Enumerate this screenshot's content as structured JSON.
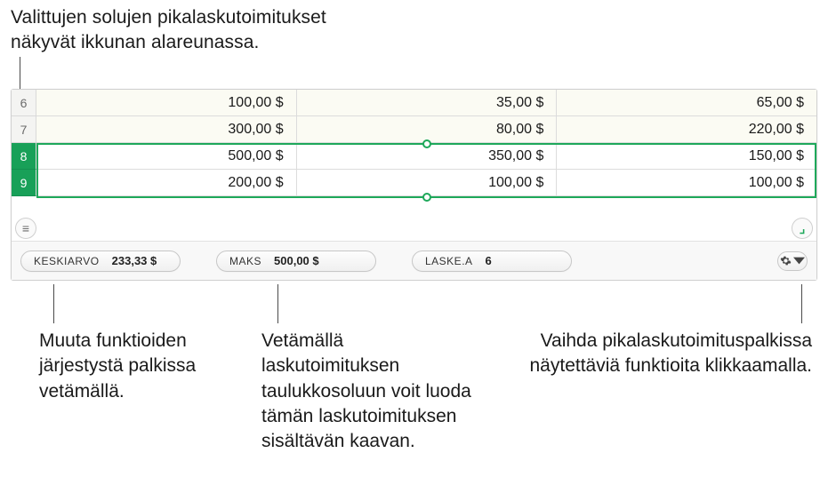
{
  "callouts": {
    "top": "Valittujen solujen pikalaskutoimitukset\nnäkyvät ikkunan alareunassa.",
    "left": "Muuta funktioiden järjestystä palkissa vetämällä.",
    "center": "Vetämällä laskutoimituksen taulukkosoluun voit luoda tämän laskutoimituksen sisältävän kaavan.",
    "right": "Vaihda pikalaskutoimituspalkissa näytettäviä funktioita klikkaamalla."
  },
  "table": {
    "rows": [
      {
        "num": "6",
        "selected": false,
        "cells": [
          "100,00 $",
          "35,00 $",
          "65,00 $"
        ]
      },
      {
        "num": "7",
        "selected": false,
        "cells": [
          "300,00 $",
          "80,00 $",
          "220,00 $"
        ]
      },
      {
        "num": "8",
        "selected": true,
        "cells": [
          "500,00 $",
          "350,00 $",
          "150,00 $"
        ]
      },
      {
        "num": "9",
        "selected": true,
        "cells": [
          "200,00 $",
          "100,00 $",
          "100,00 $"
        ]
      }
    ]
  },
  "cornerLeftGlyph": "≡",
  "cornerRightGlyph": "⌟",
  "quickbar": {
    "items": [
      {
        "label": "KESKIARVO",
        "value": "233,33 $"
      },
      {
        "label": "MAKS",
        "value": "500,00 $"
      },
      {
        "label": "LASKE.A",
        "value": "6"
      }
    ]
  }
}
